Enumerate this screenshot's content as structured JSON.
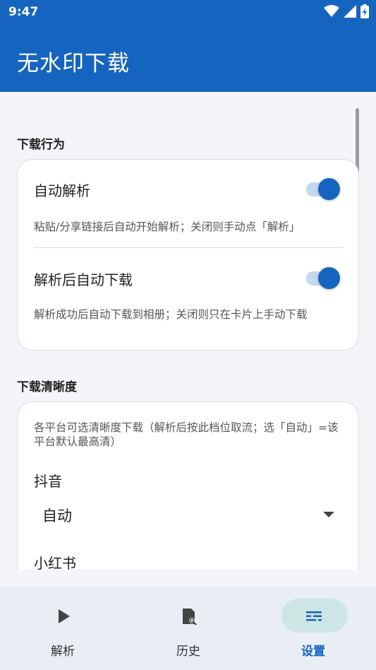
{
  "status_bar": {
    "time": "9:47"
  },
  "app_bar": {
    "title": "无水印下载"
  },
  "sections": {
    "behavior": {
      "title": "下载行为",
      "auto_parse": {
        "title": "自动解析",
        "description": "粘贴/分享链接后自动开始解析；关闭则手动点「解析」",
        "enabled": true
      },
      "auto_download": {
        "title": "解析后自动下载",
        "description": "解析成功后自动下载到相册；关闭则只在卡片上手动下载",
        "enabled": true
      }
    },
    "quality": {
      "title": "下载清晰度",
      "description": "各平台可选清晰度下载（解析后按此档位取流；选「自动」=该平台默认最高清）",
      "douyin": {
        "label": "抖音",
        "selected": "自动"
      },
      "xiaohongshu": {
        "label": "小红书"
      }
    }
  },
  "bottom_nav": {
    "items": [
      {
        "label": "解析",
        "icon": "play-icon",
        "active": false
      },
      {
        "label": "历史",
        "icon": "history-icon",
        "active": false
      },
      {
        "label": "设置",
        "icon": "settings-icon",
        "active": true
      }
    ]
  },
  "colors": {
    "primary": "#1565c0",
    "nav_active_pill": "#cde6e3",
    "toggle_track": "#c6d8ef"
  }
}
